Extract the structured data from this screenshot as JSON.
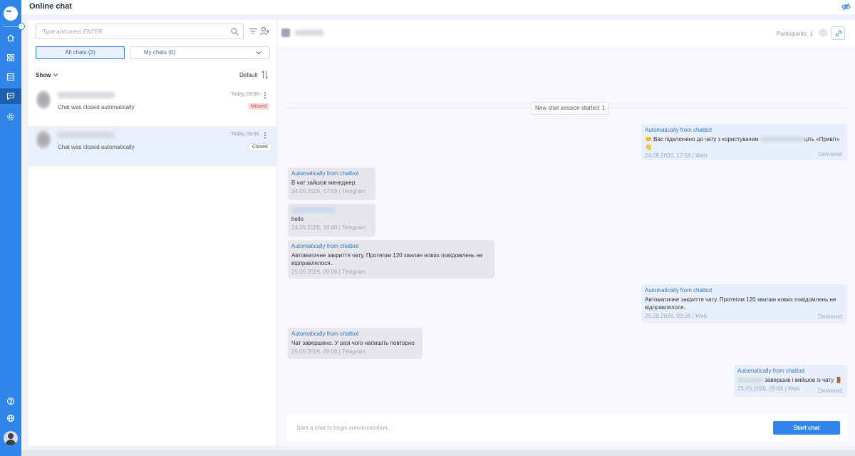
{
  "header": {
    "title": "Online chat"
  },
  "sidebar": {
    "items": [
      {
        "name": "home",
        "icon": "home-icon"
      },
      {
        "name": "dashboard",
        "icon": "grid-icon"
      },
      {
        "name": "list",
        "icon": "list-icon"
      },
      {
        "name": "chat",
        "icon": "chat-icon",
        "active": true
      },
      {
        "name": "settings",
        "icon": "gear-icon"
      }
    ],
    "bottom": [
      {
        "icon": "help-icon"
      },
      {
        "icon": "globe-icon"
      },
      {
        "icon": "avatar"
      }
    ]
  },
  "chat_list": {
    "search_placeholder": "Type and press ENTER",
    "tabs": {
      "all": "All chats (2)",
      "my": "My chats (0)"
    },
    "show_label": "Show",
    "sort_label": "Default",
    "items": [
      {
        "time": "Today, 09:06",
        "message": "Chat was closed automatically",
        "badge": "Missed"
      },
      {
        "time": "Today, 09:06",
        "message": "Chat was closed automatically",
        "badge": "Closed"
      }
    ]
  },
  "conversation": {
    "participants": "Participants: 1",
    "session_label": "New chat session started: 1",
    "messages": [
      {
        "side": "out",
        "from": "Automatically from chatbot",
        "text_a": "🤝 Вас підключено до чату з користувачем",
        "text_b": "ціть «Привіт» 👋",
        "meta": "24.09.2026, 17:59 | Web",
        "status": "Delivered"
      },
      {
        "side": "in",
        "from": "Automatically from chatbot",
        "text": "В чат зайшов менеджер:",
        "meta": "24.09.2026, 17:59 | Telegram"
      },
      {
        "side": "in",
        "text": "hello",
        "meta": "24.09.2026, 18:00 | Telegram"
      },
      {
        "side": "in",
        "from": "Automatically from chatbot",
        "text": "Автоматичне закриття чату, Протягом 120 хвилин нових повідомлень не відправлялося..",
        "meta": "25.09.2026, 09:06 | Telegram"
      },
      {
        "side": "out",
        "from": "Automatically from chatbot",
        "text": "Автоматичне закриття чату, Протягом 120 хвилин нових повідомлень не відправлялося..",
        "meta": "25.09.2026, 09:06 | Web",
        "status": "Delivered"
      },
      {
        "side": "in",
        "from": "Automatically from chatbot",
        "text": "Чат завершено. У разі чого напишіть повторно",
        "meta": "25.09.2026, 09:06 | Telegram"
      },
      {
        "side": "out",
        "from": "Automatically from chatbot",
        "text": "завершив і вийшов із чату 🚪",
        "meta": "25.09.2026, 09:06 | Web",
        "status": "Delivered"
      }
    ],
    "composer_placeholder": "Start a chat to begin communication...",
    "start_button": "Start chat"
  }
}
